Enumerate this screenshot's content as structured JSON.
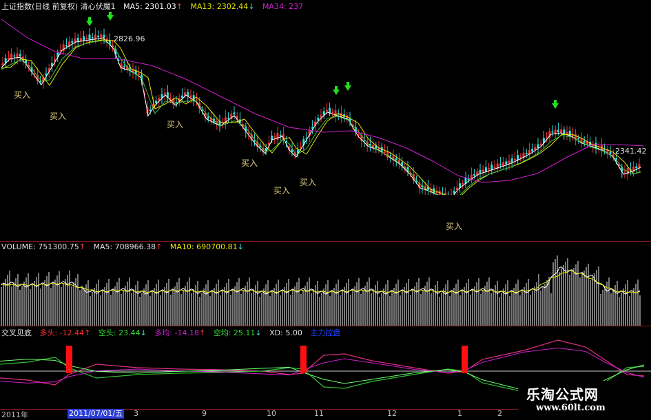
{
  "main": {
    "title": "上证指数(日线 前复权) 清心伏魔1",
    "ma5": "MA5: 2301.03",
    "ma5_arrow": "↑",
    "ma13": "MA13: 2302.44",
    "ma13_arrow": "↓",
    "ma34": "MA34: 237",
    "high_label": "2826.96",
    "last_label": "2341.42",
    "buy_label": "买入",
    "colors": {
      "up": "#ff3030",
      "down": "#30e0e0",
      "ma5": "#ffffff",
      "ma13": "#e8e800",
      "ma34": "#d020d0",
      "green_ma": "#40c040",
      "signal_arrow": "#20e020"
    }
  },
  "volume": {
    "label": "VOLUME: 751300.75",
    "label_arrow": "↑",
    "ma5": "MA5: 708966.38",
    "ma5_arrow": "↑",
    "ma10": "MA10: 690700.81",
    "ma10_arrow": "↓"
  },
  "indicator": {
    "name": "交叉见底",
    "duotou": "多头: -12.44",
    "duotou_arrow": "↑",
    "kongtou": "空头: 23.44",
    "kongtou_arrow": "↓",
    "duojun": "多均: -14.18",
    "duojun_arrow": "↑",
    "kongjun": "空均: 25.11",
    "kongjun_arrow": "↓",
    "xd": "XD: 5.00",
    "extra": "主力控盘"
  },
  "axis": {
    "year": "2011年",
    "date": "2011/07/01/五",
    "m3": "3",
    "m9": "9",
    "m10": "10",
    "m11": "11",
    "m12": "12",
    "m1": "1",
    "m2": "2"
  },
  "watermark": {
    "main": "乐淘公式网",
    "url": "www.60lt.com"
  }
}
